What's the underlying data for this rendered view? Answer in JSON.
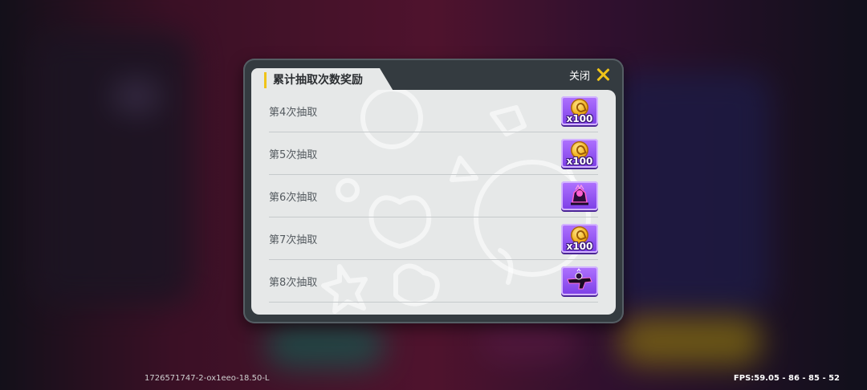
{
  "dialog": {
    "title": "累计抽取次数奖励",
    "close_label": "关闭"
  },
  "rows": [
    {
      "label": "第4次抽取",
      "reward_icon": "gold-coin-icon",
      "reward_qty": "x100"
    },
    {
      "label": "第5次抽取",
      "reward_icon": "gold-coin-icon",
      "reward_qty": "x100"
    },
    {
      "label": "第6次抽取",
      "reward_icon": "avatar-frame-icon",
      "reward_qty": ""
    },
    {
      "label": "第7次抽取",
      "reward_icon": "gold-coin-icon",
      "reward_qty": "x100"
    },
    {
      "label": "第8次抽取",
      "reward_icon": "weapon-skin-icon",
      "reward_qty": ""
    }
  ],
  "footer": {
    "build_id": "1726571747-2-ox1eeo-18.50-L",
    "fps": "FPS:59.05 - 86 - 85 - 52"
  },
  "colors": {
    "accent": "#f0c419",
    "reward_bg": "#8a4af0",
    "panel": "#e6e8e8",
    "frame": "#343b40"
  }
}
